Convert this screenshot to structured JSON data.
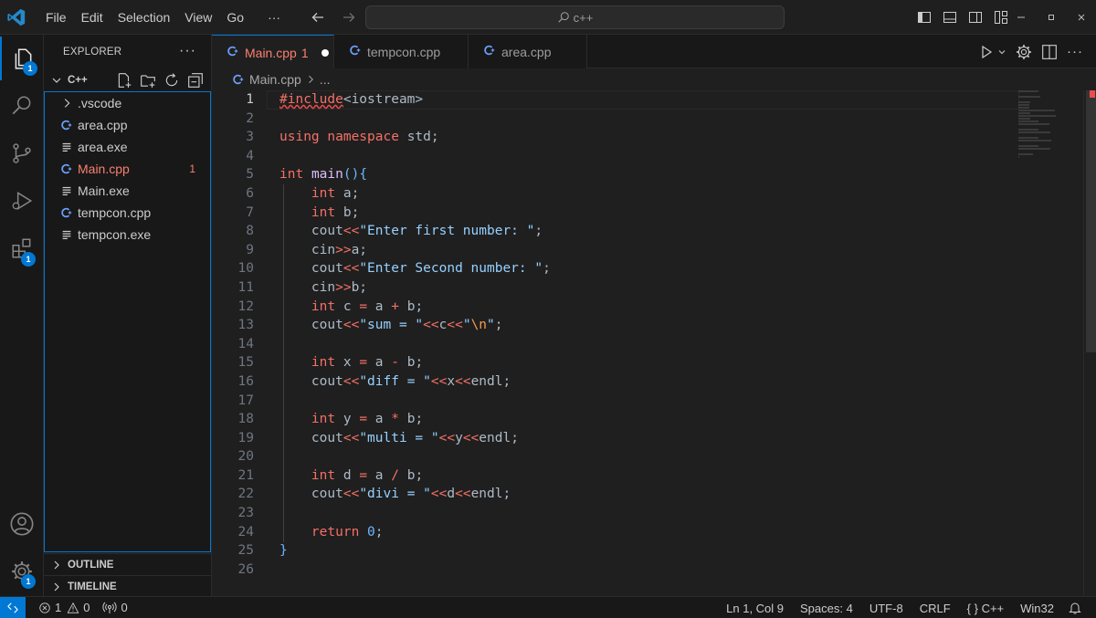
{
  "menu": [
    "File",
    "Edit",
    "Selection",
    "View",
    "Go"
  ],
  "menu_more": "···",
  "command_center": {
    "text": "c++"
  },
  "explorer": {
    "title": "EXPLORER",
    "more": "···",
    "folder": "C++",
    "items": [
      {
        "name": ".vscode",
        "type": "folder",
        "icon": "chevron-right-icon"
      },
      {
        "name": "area.cpp",
        "type": "cpp",
        "icon": "cpp-file-icon"
      },
      {
        "name": "area.exe",
        "type": "exe",
        "icon": "exe-file-icon"
      },
      {
        "name": "Main.cpp",
        "type": "cpp",
        "icon": "cpp-file-icon",
        "error": true,
        "badge": "1"
      },
      {
        "name": "Main.exe",
        "type": "exe",
        "icon": "exe-file-icon"
      },
      {
        "name": "tempcon.cpp",
        "type": "cpp",
        "icon": "cpp-file-icon"
      },
      {
        "name": "tempcon.exe",
        "type": "exe",
        "icon": "exe-file-icon"
      }
    ],
    "outline": "OUTLINE",
    "timeline": "TIMELINE"
  },
  "activity_badges": {
    "explorer": "1",
    "extensions": "1",
    "manage": "1"
  },
  "tabs": [
    {
      "label": "Main.cpp",
      "badge": "1",
      "active": true,
      "dirty": true
    },
    {
      "label": "tempcon.cpp",
      "active": false
    },
    {
      "label": "area.cpp",
      "active": false
    }
  ],
  "breadcrumb": {
    "file": "Main.cpp",
    "rest": "..."
  },
  "code_lines": [
    [
      [
        "pp",
        "#include"
      ],
      [
        "id",
        "<iostream>"
      ]
    ],
    [],
    [
      [
        "kw",
        "using"
      ],
      [
        "id",
        " "
      ],
      [
        "kw",
        "namespace"
      ],
      [
        "id",
        " std;"
      ]
    ],
    [],
    [
      [
        "ty",
        "int"
      ],
      [
        "id",
        " "
      ],
      [
        "fn",
        "main"
      ],
      [
        "br",
        "(){"
      ]
    ],
    [
      [
        "id",
        "    "
      ],
      [
        "ty",
        "int"
      ],
      [
        "id",
        " a;"
      ]
    ],
    [
      [
        "id",
        "    "
      ],
      [
        "ty",
        "int"
      ],
      [
        "id",
        " b;"
      ]
    ],
    [
      [
        "id",
        "    cout"
      ],
      [
        "op",
        "<<"
      ],
      [
        "str",
        "\"Enter first number: \""
      ],
      [
        "id",
        ";"
      ]
    ],
    [
      [
        "id",
        "    cin"
      ],
      [
        "op",
        ">>"
      ],
      [
        "id",
        "a;"
      ]
    ],
    [
      [
        "id",
        "    cout"
      ],
      [
        "op",
        "<<"
      ],
      [
        "str",
        "\"Enter Second number: \""
      ],
      [
        "id",
        ";"
      ]
    ],
    [
      [
        "id",
        "    cin"
      ],
      [
        "op",
        ">>"
      ],
      [
        "id",
        "b;"
      ]
    ],
    [
      [
        "id",
        "    "
      ],
      [
        "ty",
        "int"
      ],
      [
        "id",
        " c "
      ],
      [
        "op",
        "="
      ],
      [
        "id",
        " a "
      ],
      [
        "op",
        "+"
      ],
      [
        "id",
        " b;"
      ]
    ],
    [
      [
        "id",
        "    cout"
      ],
      [
        "op",
        "<<"
      ],
      [
        "str",
        "\"sum = \""
      ],
      [
        "op",
        "<<"
      ],
      [
        "id",
        "c"
      ],
      [
        "op",
        "<<"
      ],
      [
        "str",
        "\""
      ],
      [
        "esc",
        "\\n"
      ],
      [
        "str",
        "\""
      ],
      [
        "id",
        ";"
      ]
    ],
    [],
    [
      [
        "id",
        "    "
      ],
      [
        "ty",
        "int"
      ],
      [
        "id",
        " x "
      ],
      [
        "op",
        "="
      ],
      [
        "id",
        " a "
      ],
      [
        "op",
        "-"
      ],
      [
        "id",
        " b;"
      ]
    ],
    [
      [
        "id",
        "    cout"
      ],
      [
        "op",
        "<<"
      ],
      [
        "str",
        "\"diff = \""
      ],
      [
        "op",
        "<<"
      ],
      [
        "id",
        "x"
      ],
      [
        "op",
        "<<"
      ],
      [
        "id",
        "endl;"
      ]
    ],
    [],
    [
      [
        "id",
        "    "
      ],
      [
        "ty",
        "int"
      ],
      [
        "id",
        " y "
      ],
      [
        "op",
        "="
      ],
      [
        "id",
        " a "
      ],
      [
        "op",
        "*"
      ],
      [
        "id",
        " b;"
      ]
    ],
    [
      [
        "id",
        "    cout"
      ],
      [
        "op",
        "<<"
      ],
      [
        "str",
        "\"multi = \""
      ],
      [
        "op",
        "<<"
      ],
      [
        "id",
        "y"
      ],
      [
        "op",
        "<<"
      ],
      [
        "id",
        "endl;"
      ]
    ],
    [],
    [
      [
        "id",
        "    "
      ],
      [
        "ty",
        "int"
      ],
      [
        "id",
        " d "
      ],
      [
        "op",
        "="
      ],
      [
        "id",
        " a "
      ],
      [
        "op",
        "/"
      ],
      [
        "id",
        " b;"
      ]
    ],
    [
      [
        "id",
        "    cout"
      ],
      [
        "op",
        "<<"
      ],
      [
        "str",
        "\"divi = \""
      ],
      [
        "op",
        "<<"
      ],
      [
        "id",
        "d"
      ],
      [
        "op",
        "<<"
      ],
      [
        "id",
        "endl;"
      ]
    ],
    [],
    [
      [
        "id",
        "    "
      ],
      [
        "kw",
        "return"
      ],
      [
        "id",
        " "
      ],
      [
        "num",
        "0"
      ],
      [
        "id",
        ";"
      ]
    ],
    [
      [
        "br",
        "}"
      ]
    ],
    []
  ],
  "current_line": 1,
  "status": {
    "errors": "1",
    "warnings": "0",
    "ports": "0",
    "position": "Ln 1, Col 9",
    "spaces": "Spaces: 4",
    "encoding": "UTF-8",
    "eol": "CRLF",
    "language": "C++",
    "language_icon": "{ }",
    "platform": "Win32"
  },
  "colors": {
    "accent": "#0078d4",
    "error": "#f88070"
  }
}
